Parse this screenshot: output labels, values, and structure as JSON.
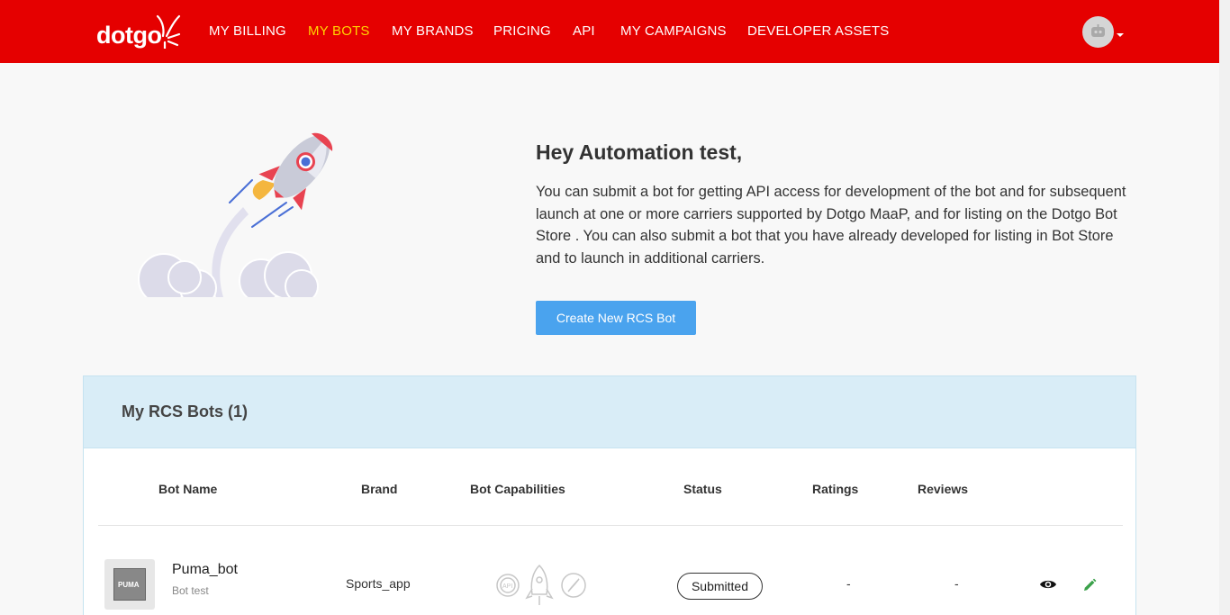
{
  "nav": {
    "logo": "dotgo",
    "items": [
      "MY BILLING",
      "MY BOTS",
      "MY BRANDS",
      "PRICING",
      "API",
      "MY CAMPAIGNS",
      "DEVELOPER ASSETS"
    ],
    "active": "MY BOTS",
    "avatar_icon": "robot-icon",
    "colors": {
      "bar": "#e50000",
      "active": "#ffd400"
    }
  },
  "hero": {
    "greeting": "Hey Automation test,",
    "intro": "You can submit a bot for getting API access for development of the bot and for subsequent launch at one or more carriers supported by Dotgo MaaP, and for listing on the Dotgo Bot Store . You can also submit a bot that you have already developed for listing in Bot Store and to launch in additional carriers.",
    "create_button": "Create New RCS Bot",
    "illustration": "rocket-illustration"
  },
  "bots": {
    "title": "My RCS Bots (1)",
    "columns": [
      "Bot Name",
      "Brand",
      "Bot Capabilities",
      "Status",
      "Ratings",
      "Reviews"
    ],
    "rows": [
      {
        "name": "Puma_bot",
        "description": "Bot test",
        "thumbnail_text": "PUMA",
        "brand": "Sports_app",
        "capabilities": [
          "api-gear-icon",
          "rocket-icon",
          "compass-icon"
        ],
        "status": "Submitted",
        "rating": "-",
        "reviews": "-"
      }
    ]
  }
}
